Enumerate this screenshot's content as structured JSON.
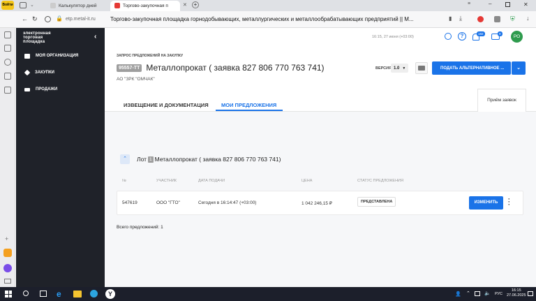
{
  "browser": {
    "ya_badge": "Войти",
    "tabs": [
      {
        "label": "Калькулятор дней"
      },
      {
        "label": "Торгово-закупочная п"
      }
    ],
    "new_tab": "+",
    "url_domain": "etp.metal-it.ru",
    "page_title": "Торгово-закупочная площадка горнодобывающих, металлургических и металлообрабатывающих предприятий || М..."
  },
  "sidebar": {
    "logo_lines": [
      "электронная",
      "торговая",
      "площадка"
    ],
    "collapse": "‹",
    "items": [
      {
        "label": "МОЯ ОРГАНИЗАЦИЯ"
      },
      {
        "label": "ЗАКУПКИ"
      },
      {
        "label": "ПРОДАЖИ"
      }
    ]
  },
  "header": {
    "datetime": "16:15, 27 июня (+03:00)",
    "notif_count": "182",
    "msg_count": "9",
    "avatar": "РО"
  },
  "request": {
    "kicker": "ЗАПРОС ПРЕДЛОЖЕНИЙ НА ЗАКУПКУ",
    "code": "95557-ТТ",
    "title": "Металлопрокат ( заявка 827 806 770 763 741)",
    "org": "АО \"ЗРК \"ОМЧАК\"",
    "version_label": "ВЕРСИЯ",
    "version_value": "1.0",
    "alt_button": "ПОДАТЬ АЛЬТЕРНАТИВНОЕ ..."
  },
  "tabs": {
    "notice": "ИЗВЕЩЕНИЕ И ДОКУМЕНТАЦИЯ",
    "my_offers": "МОИ ПРЕДЛОЖЕНИЯ",
    "status_panel": "Приём заявок"
  },
  "lot": {
    "prefix": "Лот",
    "number": "1",
    "title": "Металлопрокат ( заявка 827 806 770 763 741)"
  },
  "table": {
    "columns": [
      "№",
      "УЧАСТНИК",
      "ДАТА ПОДАЧИ",
      "ЦЕНА",
      "СТАТУС ПРЕДЛОЖЕНИЯ"
    ],
    "row": {
      "number": "547619",
      "participant": "ООО \"ГТО\"",
      "date": "Сегодня в 16:14:47 (+03:00)",
      "price": "1 042 246,15 ₽",
      "status": "ПРЕДСТАВЛЕНА",
      "action": "ИЗМЕНИТЬ"
    },
    "total": "Всего предложений: 1"
  },
  "taskbar": {
    "lang": "РУС",
    "time": "16:15",
    "date": "27.06.2025"
  }
}
